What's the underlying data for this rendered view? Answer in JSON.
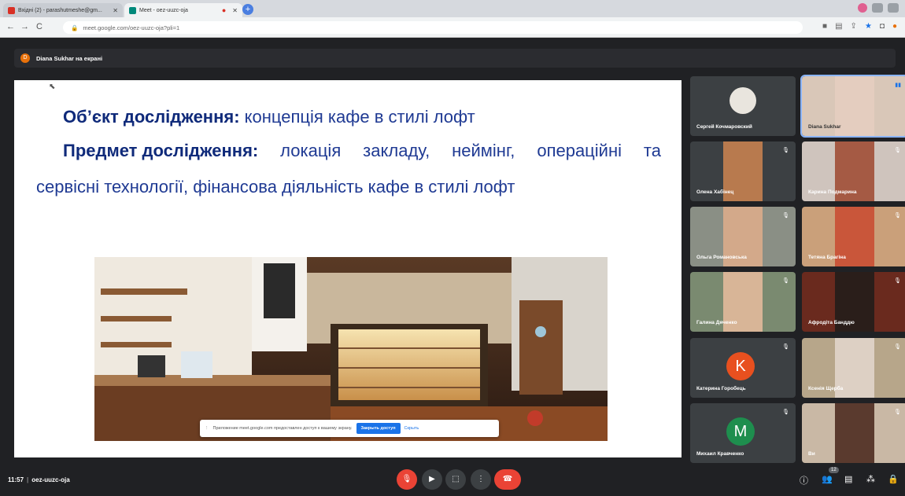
{
  "browser": {
    "tabs": [
      {
        "title": "Вхідні (2) - parashutmeshe@gm...",
        "active": false
      },
      {
        "title": "Meet - oez-uuzc-oja",
        "active": true
      }
    ],
    "new_tab": "+",
    "url": "meet.google.com/oez-uuzc-oja?pli=1",
    "nav": {
      "back": "←",
      "forward": "→",
      "reload": "C"
    }
  },
  "meet": {
    "presenter_label": "Diana Sukhar на екрані",
    "presenter_initial": "D",
    "slide": {
      "line1_bold": "Об’єкт дослідження:",
      "line1_text": " концепція кафе в стилі лофт",
      "line2_bold": "Предмет дослідження:",
      "line2_words": [
        "локація",
        "закладу,",
        "неймінг,",
        "операційні",
        "та"
      ],
      "line3_text": "сервісні технології, фінансова діяльність кафе в стилі лофт"
    },
    "share_prompt": {
      "text": "Приложение meet.google.com предоставлен доступ к вашему экрану.",
      "stop": "Закрыть доступ",
      "hide": "Скрыть"
    },
    "participants": [
      {
        "name": "Сергей Кочмаровский",
        "type": "avatar-photo"
      },
      {
        "name": "Diana Sukhar",
        "type": "video"
      },
      {
        "name": "Олена Хабінец",
        "type": "video"
      },
      {
        "name": "Карина Подмарина",
        "type": "video"
      },
      {
        "name": "Ольга Романовська",
        "type": "video"
      },
      {
        "name": "Тетяна Брагіна",
        "type": "video"
      },
      {
        "name": "Галина Дяченко",
        "type": "video"
      },
      {
        "name": "Афродіта Банддю",
        "type": "video"
      },
      {
        "name": "Катерина Горобець",
        "type": "avatar",
        "initial": "K",
        "color": "#e8501f"
      },
      {
        "name": "Ксенія Щерба",
        "type": "video"
      },
      {
        "name": "Михаил Кравченко",
        "type": "avatar",
        "initial": "M",
        "color": "#1e8e4e"
      },
      {
        "name": "Ви",
        "type": "video"
      }
    ],
    "bottom": {
      "time": "11:57",
      "separator": "|",
      "meeting_code": "oez-uuzc-oja",
      "people_count": "12"
    }
  },
  "colors": {
    "accent": "#1a73e8",
    "danger": "#ea4335",
    "slide_text": "#1f3a93"
  }
}
